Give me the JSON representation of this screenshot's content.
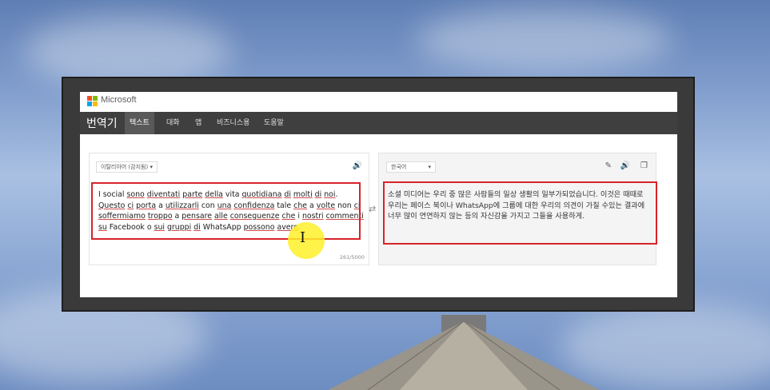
{
  "app": {
    "brand": "Microsoft",
    "title": "번역기"
  },
  "nav": {
    "items": [
      {
        "label": "텍스트",
        "active": true
      },
      {
        "label": "대화",
        "active": false
      },
      {
        "label": "앱",
        "active": false
      },
      {
        "label": "비즈니스용",
        "active": false
      },
      {
        "label": "도움말",
        "active": false
      }
    ]
  },
  "source": {
    "language": "이탈리아어 (감지됨)",
    "text_runs": [
      {
        "t": "I social ",
        "u": false
      },
      {
        "t": "sono",
        "u": true
      },
      {
        "t": " ",
        "u": false
      },
      {
        "t": "diventati",
        "u": true
      },
      {
        "t": " ",
        "u": false
      },
      {
        "t": "parte",
        "u": true
      },
      {
        "t": " ",
        "u": false
      },
      {
        "t": "della",
        "u": true
      },
      {
        "t": " vita ",
        "u": false
      },
      {
        "t": "quotidiana",
        "u": true
      },
      {
        "t": " ",
        "u": false
      },
      {
        "t": "di",
        "u": true
      },
      {
        "t": " ",
        "u": false
      },
      {
        "t": "molti",
        "u": true
      },
      {
        "t": " ",
        "u": false
      },
      {
        "t": "di",
        "u": true
      },
      {
        "t": " ",
        "u": false
      },
      {
        "t": "noi",
        "u": true
      },
      {
        "t": ". ",
        "u": false
      },
      {
        "t": "Questo",
        "u": true
      },
      {
        "t": " ",
        "u": false
      },
      {
        "t": "ci",
        "u": true
      },
      {
        "t": " ",
        "u": false
      },
      {
        "t": "porta",
        "u": true
      },
      {
        "t": " a ",
        "u": false
      },
      {
        "t": "utilizzarli",
        "u": true
      },
      {
        "t": " con ",
        "u": false
      },
      {
        "t": "una",
        "u": true
      },
      {
        "t": " ",
        "u": false
      },
      {
        "t": "confidenza",
        "u": true
      },
      {
        "t": " tale ",
        "u": false
      },
      {
        "t": "che",
        "u": true
      },
      {
        "t": " a ",
        "u": false
      },
      {
        "t": "volte",
        "u": true
      },
      {
        "t": " non ",
        "u": false
      },
      {
        "t": "ci",
        "u": true
      },
      {
        "t": " ",
        "u": false
      },
      {
        "t": "soffermiamo",
        "u": true
      },
      {
        "t": " ",
        "u": false
      },
      {
        "t": "troppo",
        "u": true
      },
      {
        "t": " a ",
        "u": false
      },
      {
        "t": "pensare",
        "u": true
      },
      {
        "t": " ",
        "u": false
      },
      {
        "t": "alle",
        "u": true
      },
      {
        "t": " ",
        "u": false
      },
      {
        "t": "conseguenze",
        "u": true
      },
      {
        "t": " ",
        "u": false
      },
      {
        "t": "che",
        "u": true
      },
      {
        "t": " i ",
        "u": false
      },
      {
        "t": "nostri",
        "u": true
      },
      {
        "t": " ",
        "u": false
      },
      {
        "t": "commenti",
        "u": true
      },
      {
        "t": " ",
        "u": false
      },
      {
        "t": "su",
        "u": true
      },
      {
        "t": " Facebook o ",
        "u": false
      },
      {
        "t": "sui",
        "u": true
      },
      {
        "t": " ",
        "u": false
      },
      {
        "t": "gruppi",
        "u": true
      },
      {
        "t": " ",
        "u": false
      },
      {
        "t": "di",
        "u": true
      },
      {
        "t": " WhatsApp ",
        "u": false
      },
      {
        "t": "possono",
        "u": true
      },
      {
        "t": " ",
        "u": false
      },
      {
        "t": "avere",
        "u": true
      },
      {
        "t": ".",
        "u": false
      }
    ],
    "char_count": "261/5000"
  },
  "target": {
    "language": "한국어",
    "text": "소셜 미디어는 우리 중 많은 사람들의 일상 생활의 일부가되었습니다. 이것은 때때로 우리는 페이스 북이나 WhatsApp에 그룹에 대한 우리의 의견이 가질 수있는 결과에 너무 많이 연연하지 않는 등의 자신감을 가지고 그들을 사용하게."
  },
  "colors": {
    "nav_bg": "#3f3f3f",
    "highlight_box": "#d8232a",
    "cursor_halo": "#fff028"
  },
  "icons": {
    "speaker": "speaker-icon",
    "swap": "swap-arrows-icon",
    "edit": "pencil-icon",
    "copy": "copy-icon"
  }
}
